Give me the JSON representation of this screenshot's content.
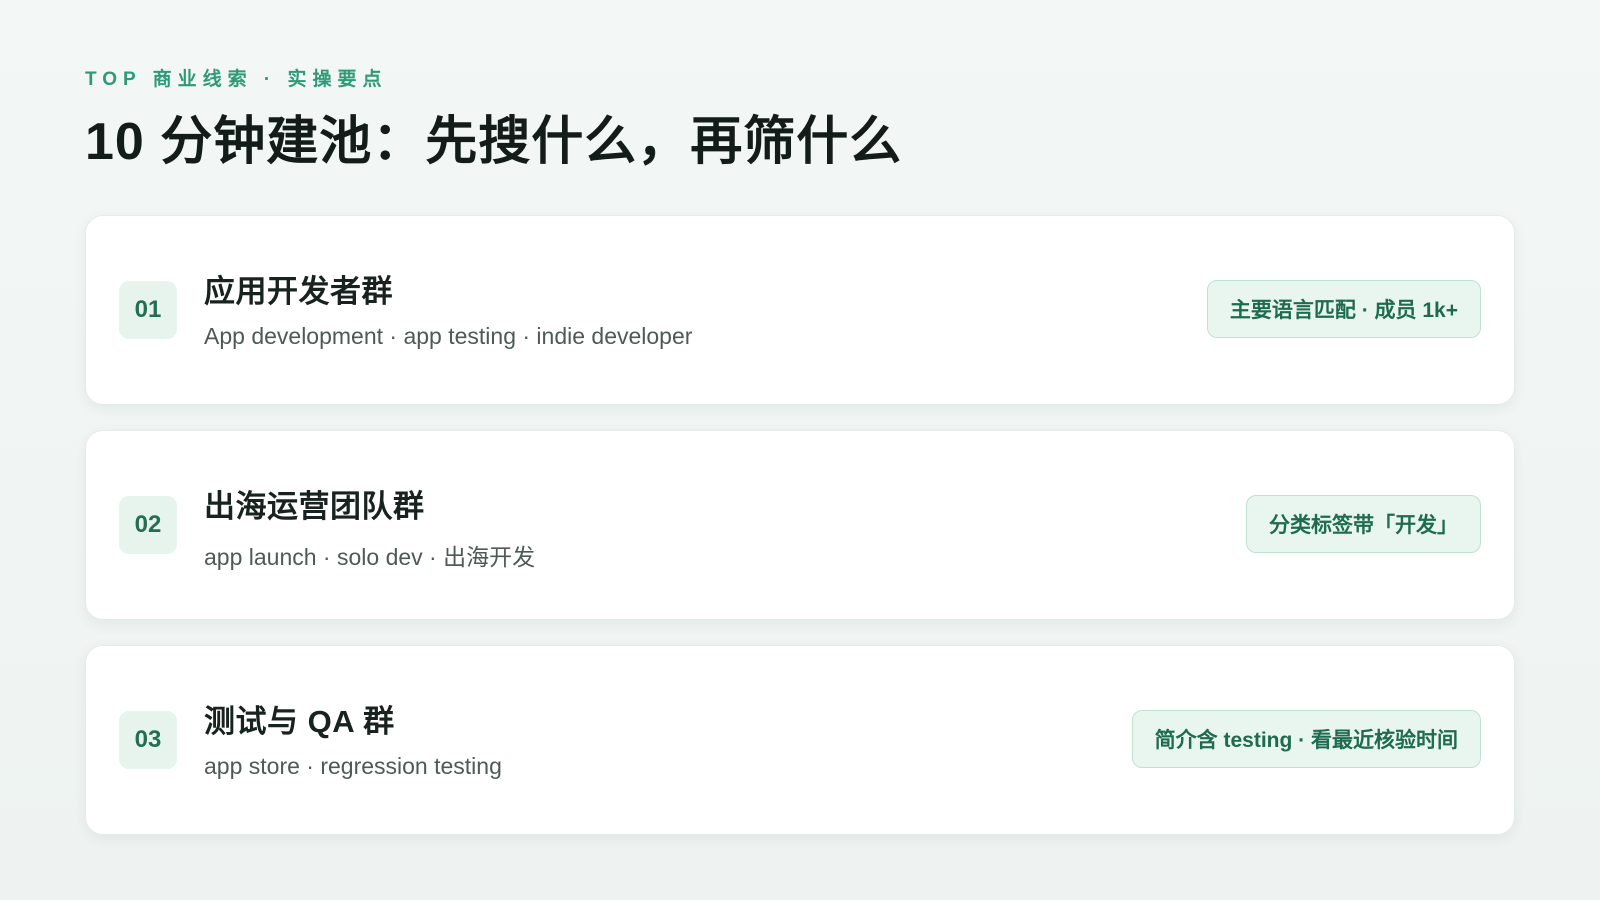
{
  "header": {
    "kicker": "TOP 商业线索 · 实操要点",
    "title": "10 分钟建池：先搜什么，再筛什么"
  },
  "items": [
    {
      "num": "01",
      "title": "应用开发者群",
      "subtitle": "App development · app testing · indie developer",
      "badge": "主要语言匹配 · 成员 1k+"
    },
    {
      "num": "02",
      "title": "出海运营团队群",
      "subtitle": "app launch · solo dev · 出海开发",
      "badge": "分类标签带「开发」"
    },
    {
      "num": "03",
      "title": "测试与 QA 群",
      "subtitle": "app store · regression testing",
      "badge": "简介含 testing · 看最近核验时间"
    }
  ]
}
